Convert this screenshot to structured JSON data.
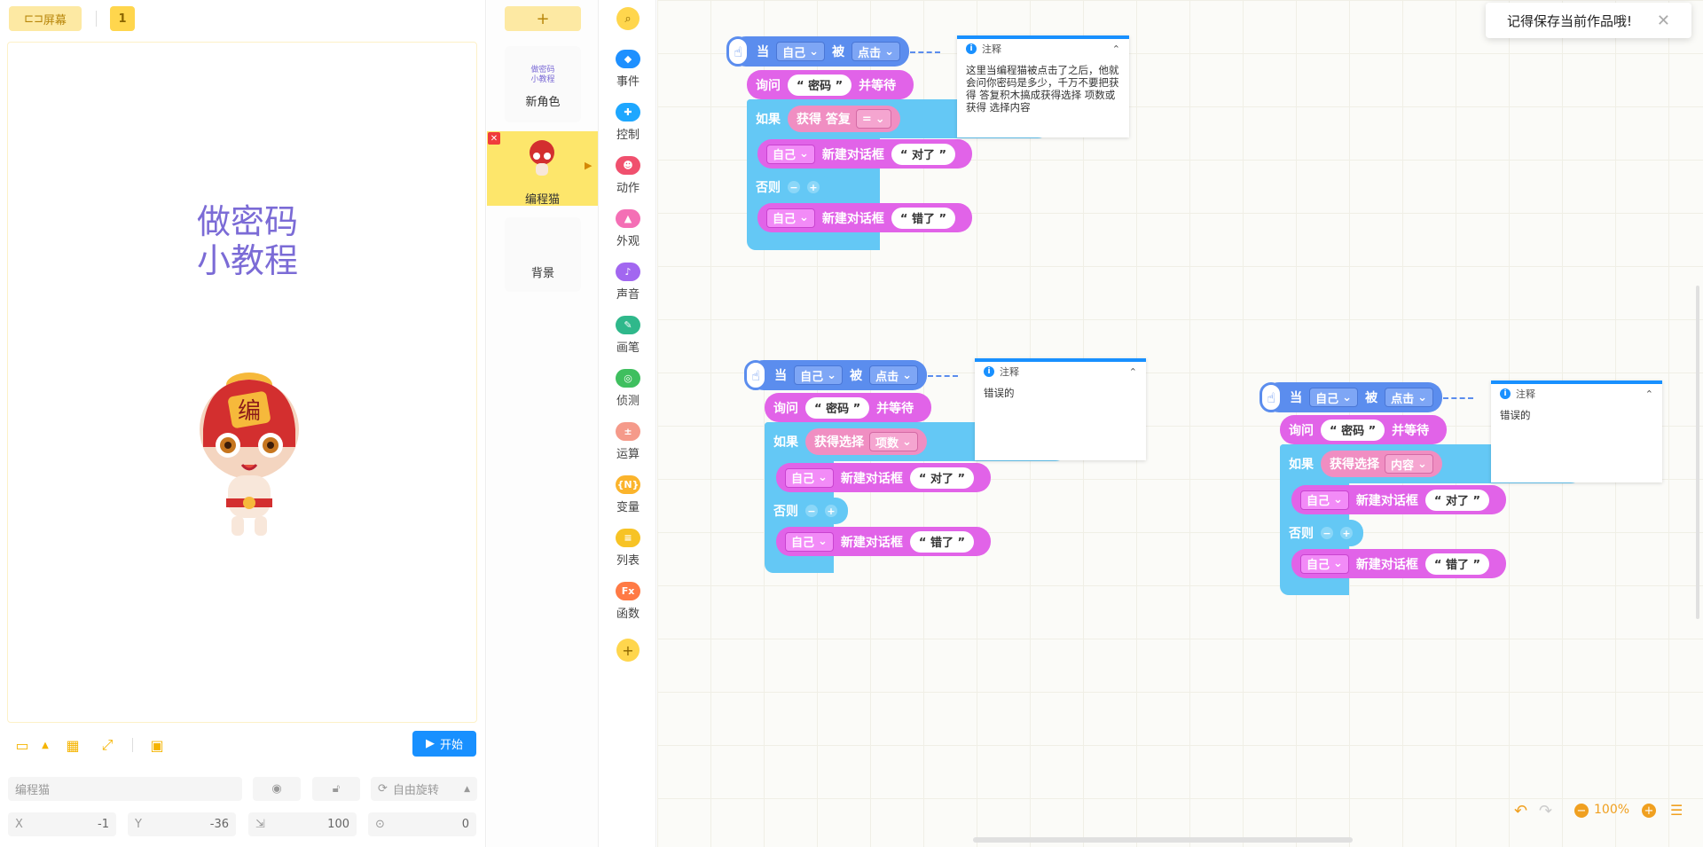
{
  "toolbar": {
    "screen_label": "屏幕",
    "screen_index": "1"
  },
  "stage": {
    "title_line1": "做密码",
    "title_line2": "小教程",
    "start_label": "开始"
  },
  "sprite_props": {
    "name_placeholder": "编程猫",
    "rotation_label": "自由旋转",
    "x_label": "X",
    "x_value": "-1",
    "y_label": "Y",
    "y_value": "-36",
    "size_value": "100",
    "direction_value": "0"
  },
  "sprites": {
    "add_label": "+",
    "new_role_label": "新角色",
    "new_role_thumb_line1": "做密码",
    "new_role_thumb_line2": "小教程",
    "cat_label": "编程猫",
    "bg_label": "背景"
  },
  "categories": [
    {
      "label": "事件",
      "color": "#1e90ff"
    },
    {
      "label": "控制",
      "color": "#1ea7ff"
    },
    {
      "label": "动作",
      "color": "#f0506e"
    },
    {
      "label": "外观",
      "color": "#f46fb5"
    },
    {
      "label": "声音",
      "color": "#a267f0"
    },
    {
      "label": "画笔",
      "color": "#2fb88b"
    },
    {
      "label": "侦测",
      "color": "#3fbf5f"
    },
    {
      "label": "运算",
      "color": "#f59a8a"
    },
    {
      "label": "变量",
      "color": "#fbb42c"
    },
    {
      "label": "列表",
      "color": "#f7c325"
    },
    {
      "label": "函数",
      "color": "#ff7a45"
    }
  ],
  "blocks": {
    "when": "当",
    "self": "自己",
    "is": "被",
    "clicked": "点击",
    "ask": "询问",
    "password": "“ 密码 ”",
    "and_wait": "并等待",
    "if": "如果",
    "get_answer": "获得 答复",
    "eq": "=",
    "get_choice": "获得选择",
    "item_count": "项数",
    "content": "内容",
    "new_dialog": "新建对话框",
    "correct": "“ 对了 ”",
    "else": "否则",
    "wrong": "“ 错了 ”"
  },
  "notes": {
    "header": "注释",
    "note1": "这里当编程猫被点击了之后，他就会问你密码是多少，千万不要把获得 答复积木搞成获得选择 项数或获得 选择内容",
    "note2": "错误的",
    "note3": "错误的"
  },
  "toast": {
    "text": "记得保存当前作品哦!"
  },
  "zoom": {
    "value": "100%"
  }
}
